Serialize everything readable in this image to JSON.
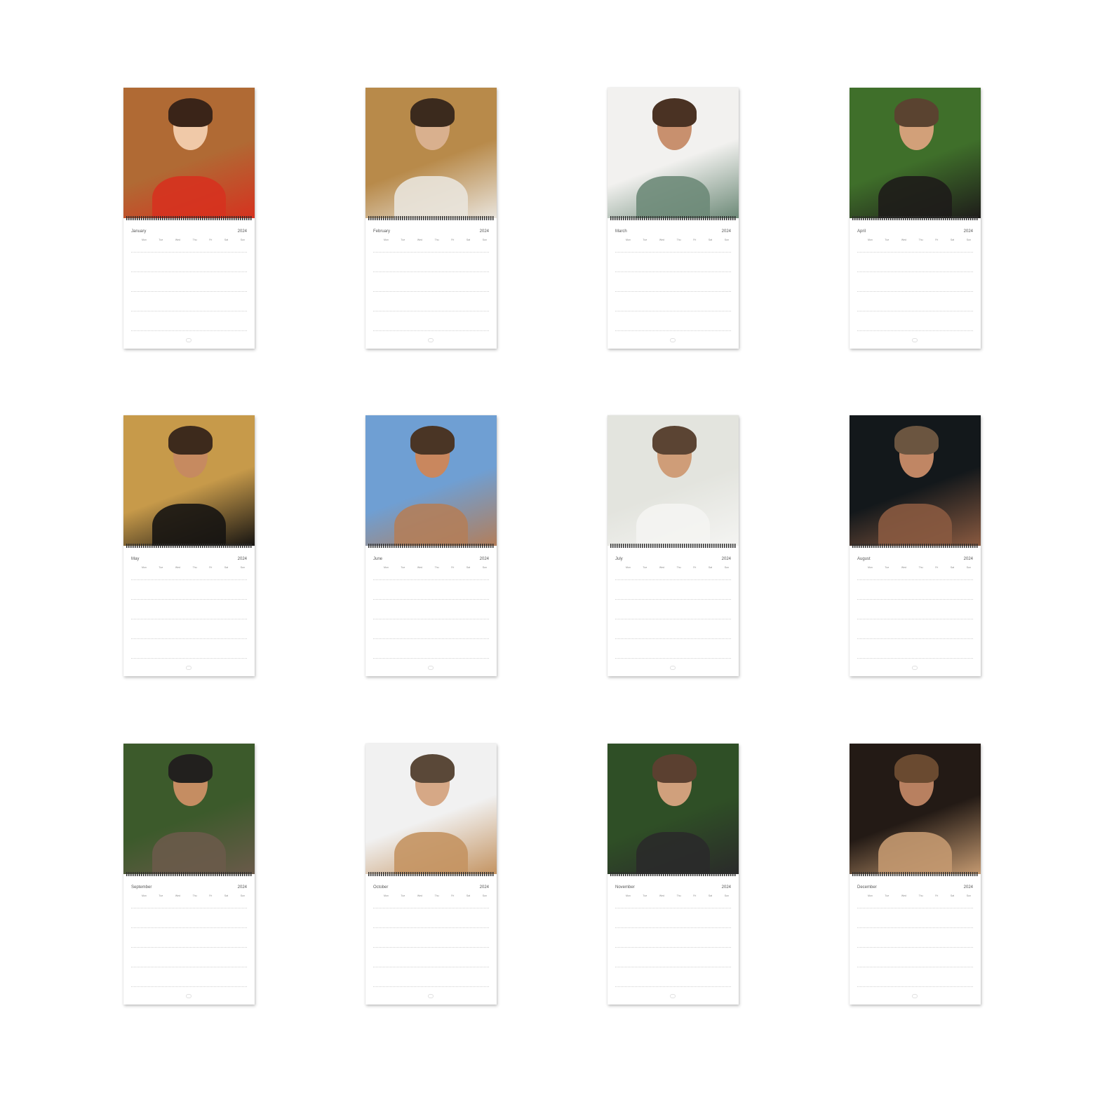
{
  "year": "2024",
  "weekdays": [
    "Mon",
    "Tue",
    "Wed",
    "Thu",
    "Fri",
    "Sat",
    "Sun"
  ],
  "months": [
    {
      "name": "January",
      "photo_colors": [
        "#b06a34",
        "#d6321f",
        "#f0c9a8",
        "#3a2418"
      ]
    },
    {
      "name": "February",
      "photo_colors": [
        "#b88a4a",
        "#e9e4dc",
        "#d9b08e",
        "#3b2a1d"
      ]
    },
    {
      "name": "March",
      "photo_colors": [
        "#f2f1ef",
        "#6d8a78",
        "#c8906e",
        "#4a3223"
      ]
    },
    {
      "name": "April",
      "photo_colors": [
        "#3f6f2a",
        "#1e1c1a",
        "#d2a079",
        "#5a4330"
      ]
    },
    {
      "name": "May",
      "photo_colors": [
        "#c79a4a",
        "#161412",
        "#c68a60",
        "#3d2a1c"
      ]
    },
    {
      "name": "June",
      "photo_colors": [
        "#6f9fd3",
        "#b37e5a",
        "#c9875e",
        "#4a3525"
      ]
    },
    {
      "name": "July",
      "photo_colors": [
        "#e3e4de",
        "#f4f4f2",
        "#cf9d78",
        "#5b4433"
      ]
    },
    {
      "name": "August",
      "photo_colors": [
        "#13181b",
        "#8a5a40",
        "#c08664",
        "#6b5540"
      ]
    },
    {
      "name": "September",
      "photo_colors": [
        "#3c5a2b",
        "#6a5a4a",
        "#c58d62",
        "#22201e"
      ]
    },
    {
      "name": "October",
      "photo_colors": [
        "#f1f1f1",
        "#c49462",
        "#d6a886",
        "#5a4838"
      ]
    },
    {
      "name": "November",
      "photo_colors": [
        "#2f4f26",
        "#2a2a2a",
        "#d0a07c",
        "#5b4030"
      ]
    },
    {
      "name": "December",
      "photo_colors": [
        "#231a15",
        "#c49970",
        "#b88060",
        "#6a4a30"
      ]
    }
  ]
}
